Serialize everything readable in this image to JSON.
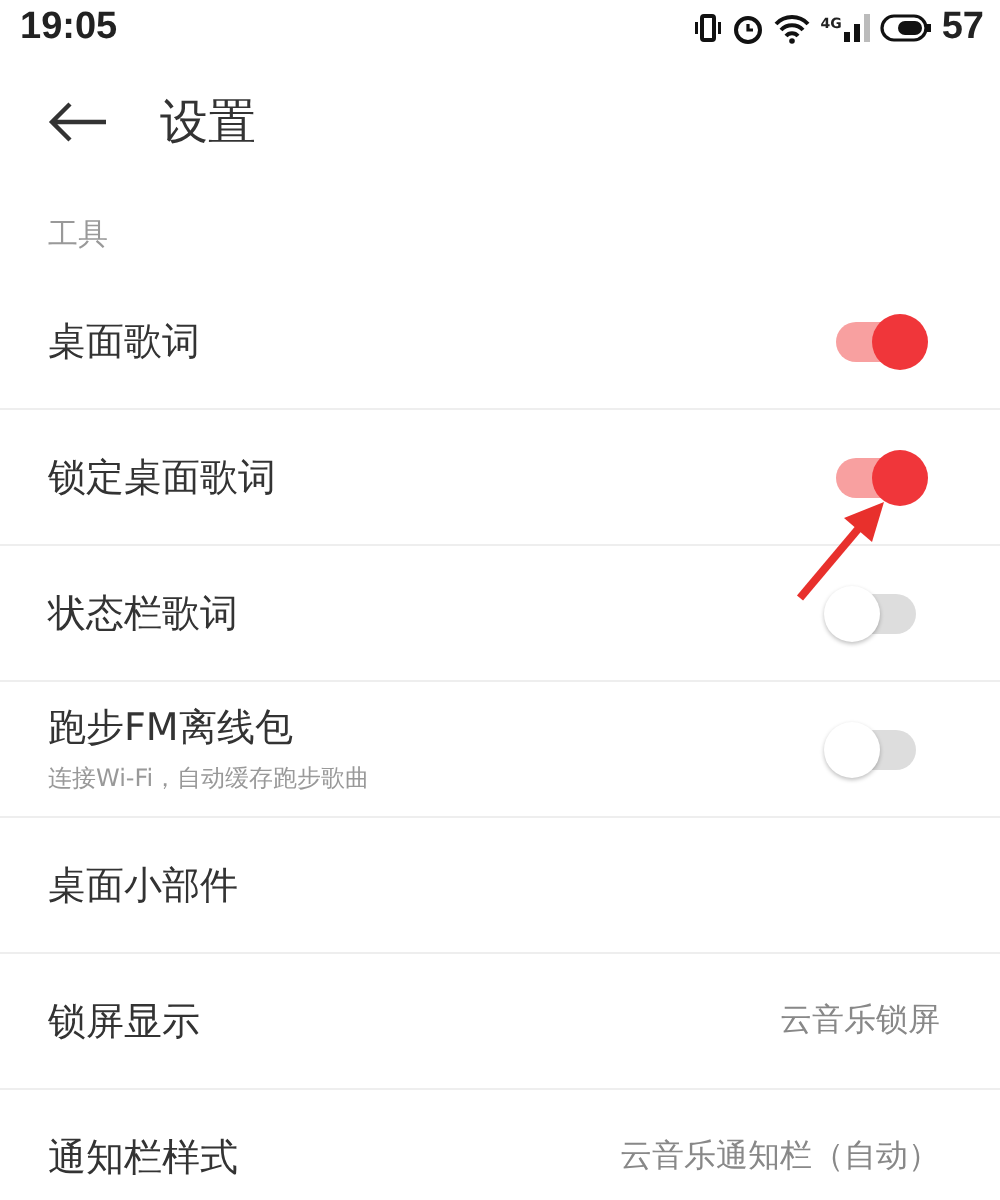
{
  "status_bar": {
    "time": "19:05",
    "network": "4G",
    "battery": "57"
  },
  "header": {
    "title": "设置"
  },
  "section": {
    "title": "工具"
  },
  "rows": [
    {
      "kind": "toggle",
      "label": "桌面歌词",
      "on": true
    },
    {
      "kind": "toggle",
      "label": "锁定桌面歌词",
      "on": true
    },
    {
      "kind": "toggle",
      "label": "状态栏歌词",
      "on": false
    },
    {
      "kind": "toggle",
      "label": "跑步FM离线包",
      "subtitle": "连接Wi-Fi，自动缓存跑步歌曲",
      "on": false
    },
    {
      "kind": "link",
      "label": "桌面小部件"
    },
    {
      "kind": "link",
      "label": "锁屏显示",
      "value": "云音乐锁屏"
    },
    {
      "kind": "link",
      "label": "通知栏样式",
      "value": "云音乐通知栏（自动）"
    }
  ]
}
